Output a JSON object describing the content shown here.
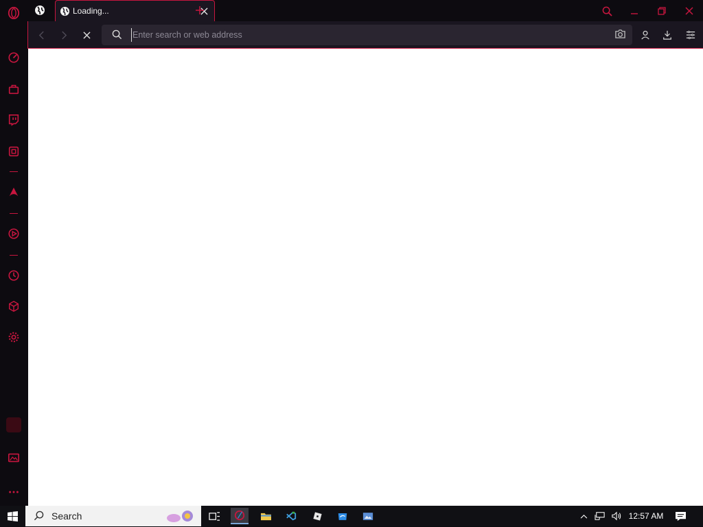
{
  "colors": {
    "accent": "#c8163f",
    "chrome_bg": "#0d0b10",
    "toolbar_bg": "#1a1620",
    "address_bg": "#2a2530",
    "content_bg": "#ffffff",
    "taskbar_bg": "#101014"
  },
  "browser": {
    "tab": {
      "title": "Loading...",
      "icon": "globe-icon"
    },
    "address": {
      "placeholder": "Enter search or web address",
      "value": ""
    },
    "sidebar_icons": [
      "opera-logo-icon",
      "speed-dial-icon",
      "bag-icon",
      "twitch-icon",
      "cube-icon",
      "aria-icon",
      "player-icon",
      "history-icon",
      "box-icon",
      "settings-icon",
      "wallpaper-icon",
      "more-icon"
    ]
  },
  "taskbar": {
    "search_label": "Search",
    "clock": "12:57 AM",
    "apps": [
      "task-view-icon",
      "opera-gx-icon",
      "file-explorer-icon",
      "vs-code-icon",
      "roblox-icon",
      "store-icon",
      "photos-icon"
    ]
  }
}
